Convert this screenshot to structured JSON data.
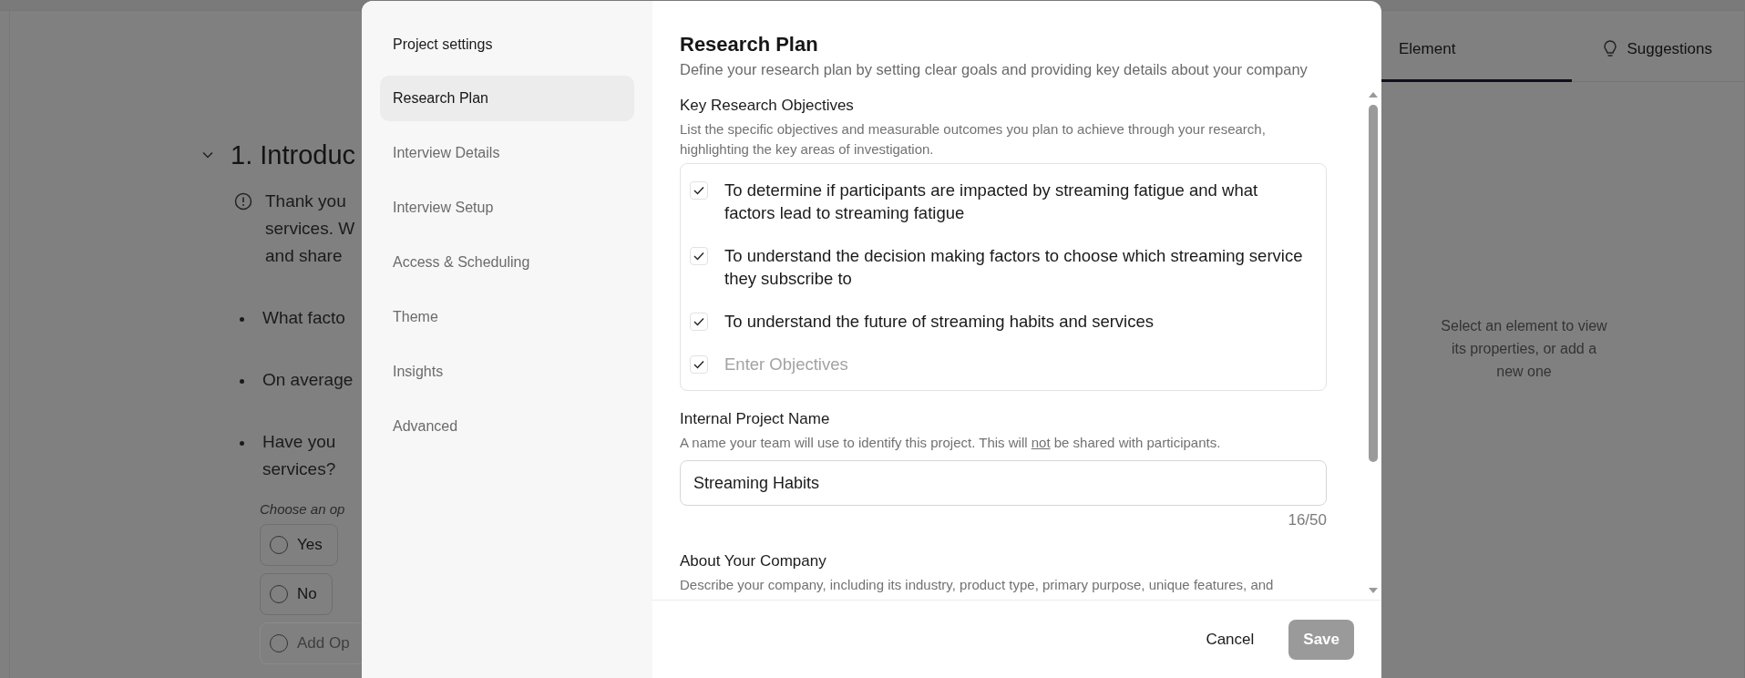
{
  "background": {
    "section": {
      "expanded": true,
      "title": "1. Introduc",
      "intro_lines": [
        "Thank you",
        "services. W",
        "and share"
      ],
      "bullets": [
        {
          "lines": [
            "What facto"
          ]
        },
        {
          "lines": [
            "On average"
          ]
        },
        {
          "lines": [
            "Have you",
            "services?"
          ]
        }
      ],
      "hint": "Choose an op",
      "options": [
        {
          "kind": "option",
          "label": "Yes",
          "selected": false
        },
        {
          "kind": "option",
          "label": "No",
          "selected": false
        },
        {
          "kind": "add",
          "label": "Add Op",
          "selected": false
        }
      ]
    },
    "side_panel": {
      "tabs": [
        {
          "label": "Element",
          "selected": true
        },
        {
          "label": "Suggestions",
          "selected": false
        }
      ],
      "empty_message": "Select an element to view its properties, or add a new one"
    }
  },
  "dialog": {
    "nav_title": "Project settings",
    "nav": [
      {
        "label": "Research Plan",
        "selected": true
      },
      {
        "label": "Interview Details",
        "selected": false
      },
      {
        "label": "Interview Setup",
        "selected": false
      },
      {
        "label": "Access & Scheduling",
        "selected": false
      },
      {
        "label": "Theme",
        "selected": false
      },
      {
        "label": "Insights",
        "selected": false
      },
      {
        "label": "Advanced",
        "selected": false
      }
    ],
    "title": "Research Plan",
    "subtitle": "Define your research plan by setting clear goals and providing key details about your company",
    "objectives": {
      "label": "Key Research Objectives",
      "help": "List the specific objectives and measurable outcomes you plan to achieve through your research, highlighting the key areas of investigation.",
      "items": [
        {
          "kind": "text",
          "checked": true,
          "text": "To determine if participants are impacted by streaming fatigue and what factors lead to streaming fatigue"
        },
        {
          "kind": "text",
          "checked": true,
          "text": "To understand the decision making factors to choose which streaming service they subscribe to"
        },
        {
          "kind": "text",
          "checked": true,
          "text": "To understand the future of streaming habits and services"
        },
        {
          "kind": "input",
          "checked": true,
          "placeholder": "Enter Objectives"
        }
      ]
    },
    "project_name": {
      "label": "Internal Project Name",
      "help": [
        "A name your team will use to identify this project. This will ",
        "not",
        " be shared with participants."
      ],
      "value": "Streaming Habits",
      "counter": "16/50"
    },
    "company": {
      "label": "About Your Company",
      "help": "Describe your company, including its industry, product type, primary purpose, unique features, and"
    },
    "buttons": [
      {
        "kind": "secondary",
        "label": "Cancel",
        "disabled": false
      },
      {
        "kind": "primary",
        "label": "Save",
        "disabled": true
      }
    ]
  }
}
